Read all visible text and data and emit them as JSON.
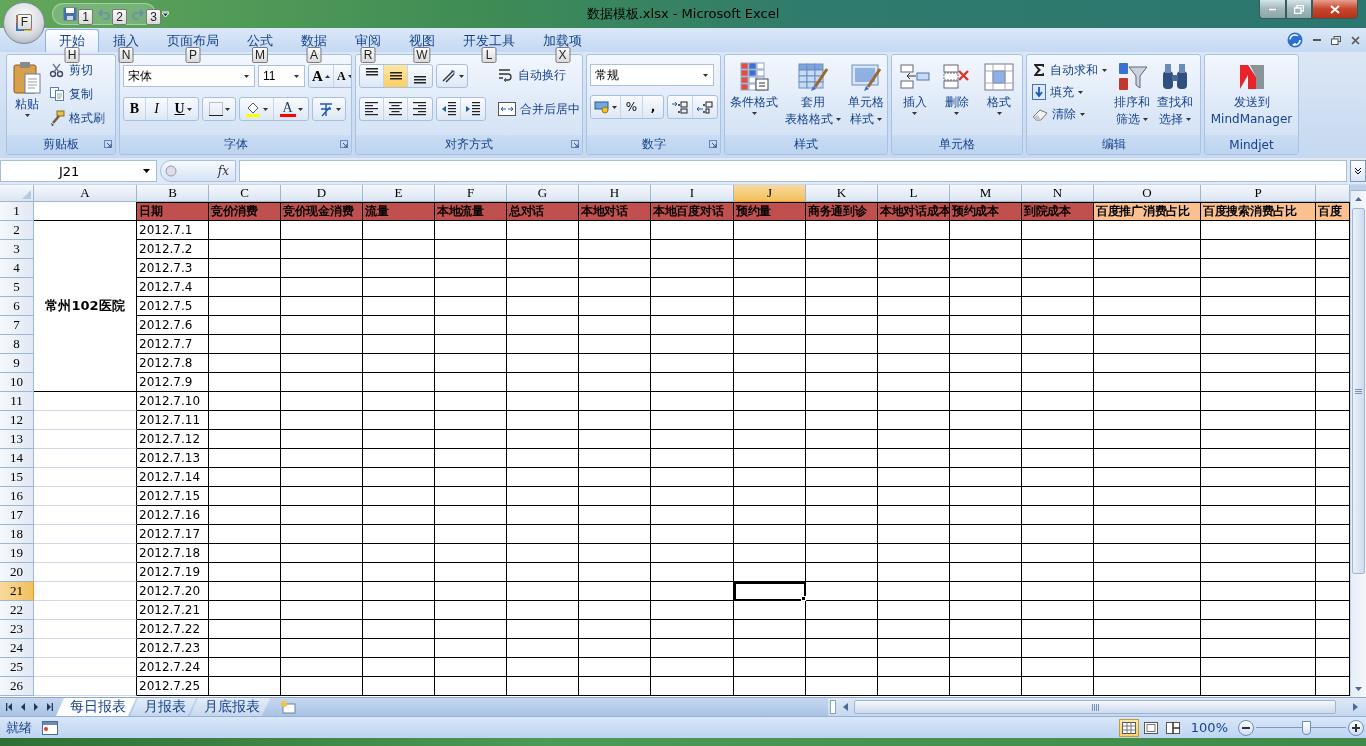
{
  "window": {
    "title": "数据模板.xlsx - Microsoft Excel"
  },
  "office_button": {
    "keytip": "F"
  },
  "quick_access": [
    {
      "kind": "save",
      "keytip": "1"
    },
    {
      "kind": "undo",
      "keytip": "2"
    },
    {
      "kind": "redo",
      "keytip": "3"
    }
  ],
  "ribbon_tabs": [
    {
      "label": "开始",
      "keytip": "H",
      "selected": true
    },
    {
      "label": "插入",
      "keytip": "N",
      "selected": false
    },
    {
      "label": "页面布局",
      "keytip": "P",
      "selected": false
    },
    {
      "label": "公式",
      "keytip": "M",
      "selected": false
    },
    {
      "label": "数据",
      "keytip": "A",
      "selected": false
    },
    {
      "label": "审阅",
      "keytip": "R",
      "selected": false
    },
    {
      "label": "视图",
      "keytip": "W",
      "selected": false
    },
    {
      "label": "开发工具",
      "keytip": "L",
      "selected": false
    },
    {
      "label": "加载项",
      "keytip": "X",
      "selected": false
    }
  ],
  "clipboard": {
    "title": "剪贴板",
    "paste": "粘贴",
    "items": [
      {
        "kind": "cut",
        "label": "剪切"
      },
      {
        "kind": "copy",
        "label": "复制"
      },
      {
        "kind": "painter",
        "label": "格式刷"
      }
    ]
  },
  "font": {
    "title": "字体",
    "font_name": "宋体",
    "font_size": "11",
    "grow": "A",
    "shrink": "A",
    "styles": [
      "B",
      "I",
      "U"
    ],
    "font_color": "A"
  },
  "alignment": {
    "title": "对齐方式",
    "vertical": [
      {
        "selected": false
      },
      {
        "selected": true
      },
      {
        "selected": false
      }
    ],
    "wrap": "自动换行",
    "merge": "合并后居中"
  },
  "number": {
    "title": "数字",
    "format": "常规",
    "percent": "%",
    "comma": ","
  },
  "styles": {
    "title": "样式",
    "buttons": [
      {
        "kind": "conditional",
        "lines": [
          "条件格式"
        ]
      },
      {
        "kind": "table",
        "lines": [
          "套用",
          "表格格式"
        ]
      },
      {
        "kind": "cellstyle",
        "lines": [
          "单元格",
          "样式"
        ]
      }
    ]
  },
  "cells": {
    "title": "单元格",
    "buttons": [
      {
        "kind": "insert",
        "lines": [
          "插入"
        ]
      },
      {
        "kind": "delete",
        "lines": [
          "删除"
        ]
      },
      {
        "kind": "format",
        "lines": [
          "格式"
        ]
      }
    ]
  },
  "editing": {
    "title": "编辑",
    "items": [
      {
        "kind": "sum",
        "label": "自动求和"
      },
      {
        "kind": "fill",
        "label": "填充"
      },
      {
        "kind": "clear",
        "label": "清除"
      }
    ],
    "buttons": [
      {
        "kind": "sort",
        "lines": [
          "排序和",
          "筛选"
        ]
      },
      {
        "kind": "find",
        "lines": [
          "查找和",
          "选择"
        ]
      }
    ]
  },
  "mindjet": {
    "title": "Mindjet",
    "lines": [
      "发送到",
      "MindManager"
    ]
  },
  "formula_bar": {
    "name_box": "J21",
    "fx": "fx"
  },
  "columns": [
    {
      "letter": "A",
      "selected": false
    },
    {
      "letter": "B",
      "title": "日期",
      "color": "#c0504d",
      "selected": false
    },
    {
      "letter": "C",
      "title": "竞价消费",
      "color": "#c0504d",
      "selected": false
    },
    {
      "letter": "D",
      "title": "竞价现金消费",
      "color": "#c0504d",
      "selected": false
    },
    {
      "letter": "E",
      "title": "流量",
      "color": "#c0504d",
      "selected": false
    },
    {
      "letter": "F",
      "title": "本地流量",
      "color": "#c0504d",
      "selected": false
    },
    {
      "letter": "G",
      "title": "总对话",
      "color": "#c0504d",
      "selected": false
    },
    {
      "letter": "H",
      "title": "本地对话",
      "color": "#c0504d",
      "selected": false
    },
    {
      "letter": "I",
      "title": "本地百度对话",
      "color": "#c0504d",
      "selected": false
    },
    {
      "letter": "J",
      "title": "预约量",
      "color": "#c0504d",
      "selected": true
    },
    {
      "letter": "K",
      "title": "商务通到诊",
      "color": "#c0504d",
      "selected": false
    },
    {
      "letter": "L",
      "title": "本地对话成本",
      "color": "#c0504d",
      "selected": false
    },
    {
      "letter": "M",
      "title": "预约成本",
      "color": "#c0504d",
      "selected": false
    },
    {
      "letter": "N",
      "title": "到院成本",
      "color": "#c0504d",
      "selected": false
    },
    {
      "letter": "O",
      "title": "百度推广消费占比",
      "color": "#fac090",
      "selected": false
    },
    {
      "letter": "P",
      "title": "百度搜索消费占比",
      "color": "#fac090",
      "selected": false
    },
    {
      "title": "百度",
      "color": "#fac090",
      "selected": false
    }
  ],
  "rows": [
    {
      "number": "1",
      "selected": false
    },
    {
      "number": "2",
      "label": "常州102医院",
      "date": "2012.7.1",
      "selected": false
    },
    {
      "number": "3",
      "merged_above": true,
      "date": "2012.7.2",
      "selected": false
    },
    {
      "number": "4",
      "merged_above": true,
      "date": "2012.7.3",
      "selected": false
    },
    {
      "number": "5",
      "merged_above": true,
      "date": "2012.7.4",
      "selected": false
    },
    {
      "number": "6",
      "merged_above": true,
      "date": "2012.7.5",
      "selected": false
    },
    {
      "number": "7",
      "merged_above": true,
      "date": "2012.7.6",
      "selected": false
    },
    {
      "number": "8",
      "merged_above": true,
      "date": "2012.7.7",
      "selected": false
    },
    {
      "number": "9",
      "merged_above": true,
      "date": "2012.7.8",
      "selected": false
    },
    {
      "number": "10",
      "merged_above": true,
      "date": "2012.7.9",
      "selected": false
    },
    {
      "number": "11",
      "date": "2012.7.10",
      "selected": false
    },
    {
      "number": "12",
      "date": "2012.7.11",
      "selected": false
    },
    {
      "number": "13",
      "date": "2012.7.12",
      "selected": false
    },
    {
      "number": "14",
      "date": "2012.7.13",
      "selected": false
    },
    {
      "number": "15",
      "date": "2012.7.14",
      "selected": false
    },
    {
      "number": "16",
      "date": "2012.7.15",
      "selected": false
    },
    {
      "number": "17",
      "date": "2012.7.16",
      "selected": false
    },
    {
      "number": "18",
      "date": "2012.7.17",
      "selected": false
    },
    {
      "number": "19",
      "date": "2012.7.18",
      "selected": false
    },
    {
      "number": "20",
      "date": "2012.7.19",
      "selected": false
    },
    {
      "number": "21",
      "date": "2012.7.20",
      "selected": true
    },
    {
      "number": "22",
      "date": "2012.7.21",
      "selected": false
    },
    {
      "number": "23",
      "date": "2012.7.22",
      "selected": false
    },
    {
      "number": "24",
      "date": "2012.7.23",
      "selected": false
    },
    {
      "number": "25",
      "date": "2012.7.24",
      "selected": false
    },
    {
      "number": "26",
      "date": "2012.7.25",
      "selected": false
    }
  ],
  "sheet_tabs": [
    {
      "label": "每日报表",
      "selected": true
    },
    {
      "label": "月报表",
      "selected": false
    },
    {
      "label": "月底报表",
      "selected": false
    }
  ],
  "status_bar": {
    "status": "就绪",
    "views": [
      {
        "kind": "normal",
        "selected": true
      },
      {
        "kind": "layout",
        "selected": false
      },
      {
        "kind": "break",
        "selected": false
      }
    ],
    "zoom": "100%",
    "zoom_slider": {
      "level": 0.55
    }
  }
}
